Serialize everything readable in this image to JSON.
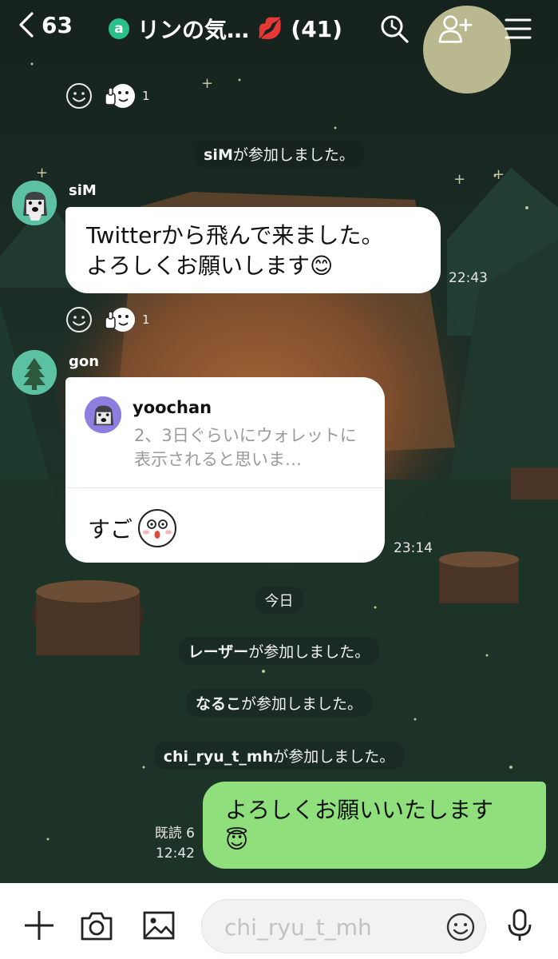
{
  "header": {
    "back_count": "63",
    "group_badge": "a",
    "title": "リンの気…",
    "title_emoji": "💋",
    "member_count": "(41)",
    "icons": [
      "chevron-left-icon",
      "search-icon",
      "add-friend-icon",
      "menu-icon"
    ]
  },
  "messages": {
    "reaction_top": {
      "count": "1"
    },
    "sys_join_sim": {
      "name": "siM",
      "text": "が参加しました。"
    },
    "sim_msg": {
      "sender": "siM",
      "line1": "Twitterから飛んで来ました。",
      "line2": "よろしくお願いします",
      "emoji": "😊",
      "time": "22:43"
    },
    "reaction_mid": {
      "count": "1"
    },
    "gon_msg": {
      "sender": "gon",
      "reply_name": "yoochan",
      "reply_text": "2、3日ぐらいにウォレットに表示されると思いま…",
      "text": "すご",
      "time": "23:14"
    },
    "date_divider": "今日",
    "sys_join_laser": {
      "name": "レーザー",
      "text": "が参加しました。"
    },
    "sys_join_naruko": {
      "name": "なるこ",
      "text": "が参加しました。"
    },
    "sys_join_chiryu": {
      "name": "chi_ryu_t_mh",
      "text": "が参加しました。"
    },
    "my_msg": {
      "text": "よろしくお願いいたします",
      "emoji": "😇",
      "read": "既読 6",
      "time": "12:42"
    }
  },
  "input_bar": {
    "placeholder": "chi_ryu_t_mh",
    "icons": [
      "plus-icon",
      "camera-icon",
      "image-icon",
      "emoji-icon",
      "microphone-icon"
    ]
  },
  "colors": {
    "my_bubble": "#8fe07c",
    "other_bubble": "#ffffff",
    "avatar_bg": "#5cc0a3",
    "badge": "#2bbf8a"
  }
}
